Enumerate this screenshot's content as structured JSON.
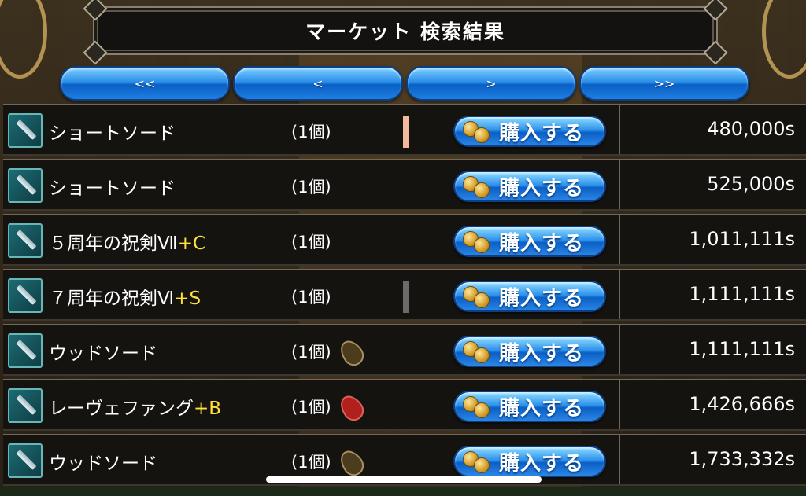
{
  "title": "マーケット 検索結果",
  "nav": {
    "first": "<<",
    "prev": "<",
    "next": ">",
    "last": ">>"
  },
  "buy_label": "購入する",
  "rows": [
    {
      "name": "ショートソード",
      "suffix": "",
      "qty": "(1個)",
      "marker": "peach",
      "price": "480,000s"
    },
    {
      "name": "ショートソード",
      "suffix": "",
      "qty": "(1個)",
      "marker": "",
      "price": "525,000s"
    },
    {
      "name": "５周年の祝剣Ⅶ",
      "suffix": "+C",
      "qty": "(1個)",
      "marker": "",
      "price": "1,011,111s"
    },
    {
      "name": "７周年の祝剣Ⅵ",
      "suffix": "+S",
      "qty": "(1個)",
      "marker": "gray",
      "price": "1,111,111s"
    },
    {
      "name": "ウッドソード",
      "suffix": "",
      "qty": "(1個)",
      "marker": "seed-brown",
      "price": "1,111,111s"
    },
    {
      "name": "レーヴェファング",
      "suffix": "+B",
      "qty": "(1個)",
      "marker": "seed-red",
      "price": "1,426,666s"
    },
    {
      "name": "ウッドソード",
      "suffix": "",
      "qty": "(1個)",
      "marker": "seed-brown",
      "price": "1,733,332s"
    }
  ],
  "colors": {
    "peach": "#f2b99a",
    "gray": "#6b6b6b",
    "seed-brown": "#4a3c1c",
    "seed-red": "#b0201c",
    "suffix": "#ffe23a"
  }
}
